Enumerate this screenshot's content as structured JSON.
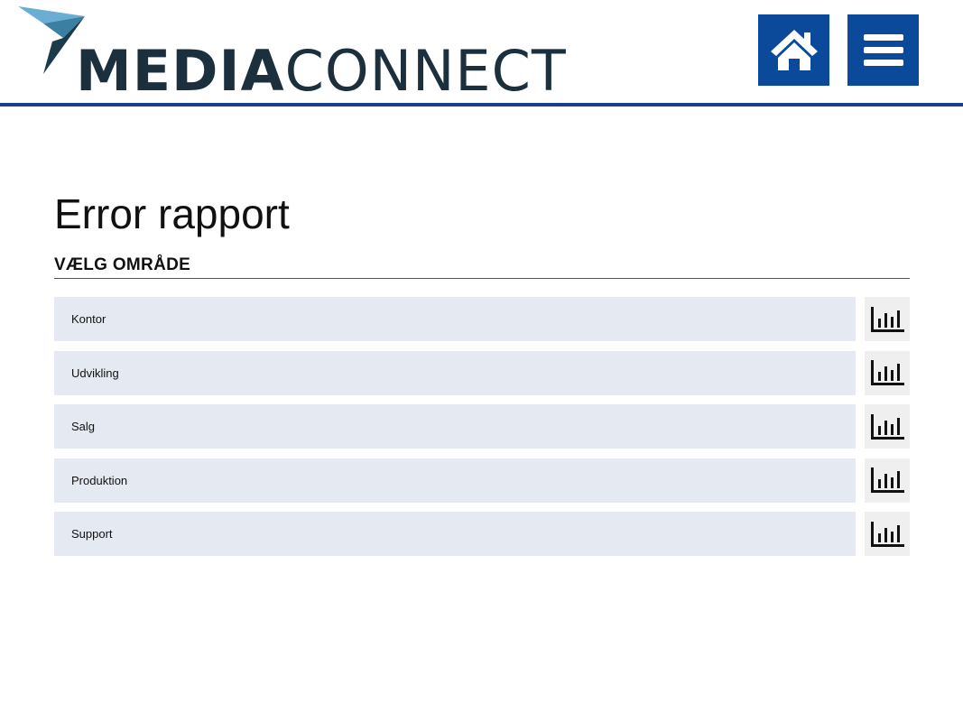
{
  "header": {
    "logo": {
      "bold": "MEDIA",
      "light": "CONNECT",
      "colors": {
        "text": "#1c2f3d",
        "mark_light": "#6aaed3",
        "mark_mid": "#3b7fa3",
        "mark_dark": "#1c3b4a"
      }
    },
    "home_icon": "home-icon",
    "menu_icon": "hamburger-menu-icon",
    "accent": "#0b4a9b"
  },
  "page": {
    "title": "Error rapport",
    "subtitle": "VÆLG OMRÅDE"
  },
  "areas": [
    {
      "label": "Kontor",
      "icon": "bar-chart-icon"
    },
    {
      "label": "Udvikling",
      "icon": "bar-chart-icon"
    },
    {
      "label": "Salg",
      "icon": "bar-chart-icon"
    },
    {
      "label": "Produktion",
      "icon": "bar-chart-icon"
    },
    {
      "label": "Support",
      "icon": "bar-chart-icon"
    }
  ]
}
